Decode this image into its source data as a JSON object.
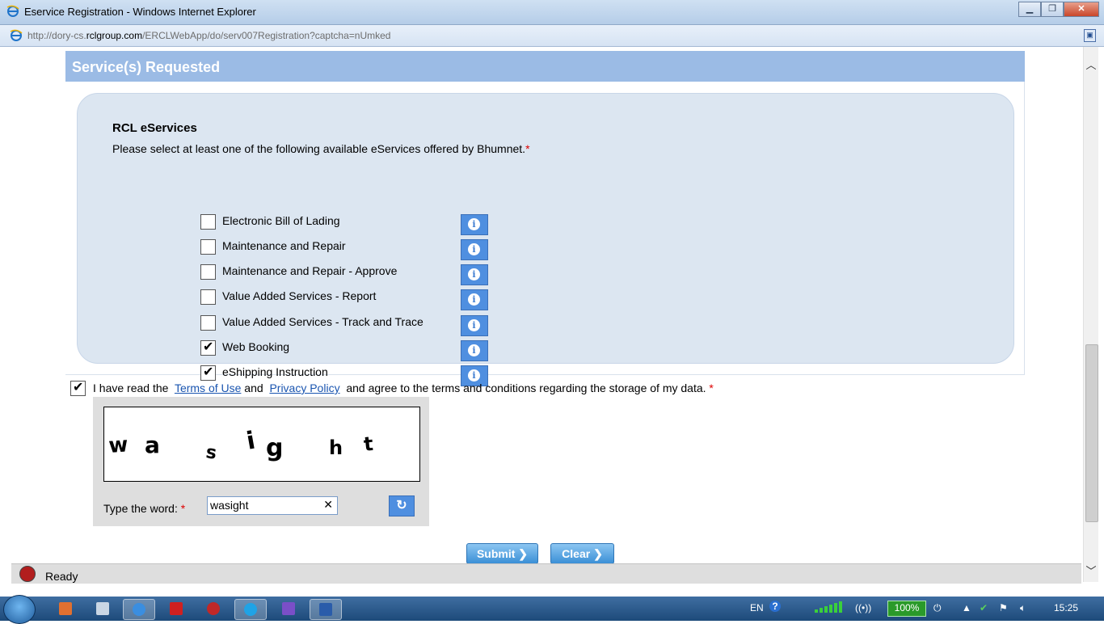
{
  "window": {
    "title": "Eservice Registration - Windows Internet Explorer",
    "url_prefix": "http://dory-cs.",
    "url_domain": "rclgroup.com",
    "url_path": "/ERCLWebApp/do/serv007Registration?captcha=nUmked",
    "minimize": "▁",
    "restore": "❐",
    "close": "✕"
  },
  "section": {
    "title": "Service(s) Requested"
  },
  "panel": {
    "title": "RCL eServices",
    "description": "Please select at least one of the following available eServices offered by Bhumnet.",
    "required_mark": "*"
  },
  "services": [
    {
      "label": "Electronic Bill of Lading",
      "checked": false
    },
    {
      "label": "Maintenance and Repair",
      "checked": false
    },
    {
      "label": "Maintenance and Repair - Approve",
      "checked": false
    },
    {
      "label": "Value Added Services - Report",
      "checked": false
    },
    {
      "label": "Value Added Services - Track and Trace",
      "checked": false
    },
    {
      "label": "Web Booking",
      "checked": true
    },
    {
      "label": "eShipping Instruction",
      "checked": true
    }
  ],
  "info_glyph": "i",
  "terms": {
    "checked": true,
    "prefix": "I have read the",
    "terms_link": "Terms of Use",
    "and": "and",
    "privacy_link": "Privacy Policy",
    "suffix": "and agree to the terms and conditions regarding the storage of my data.",
    "required_mark": "*"
  },
  "captcha": {
    "image_word": "wasight",
    "label": "Type the word:",
    "required_mark": "*",
    "value": "wasight",
    "clear_glyph": "✕",
    "refresh_glyph": "↻"
  },
  "buttons": {
    "submit": "Submit ❯",
    "clear": "Clear ❯"
  },
  "status": {
    "text": "Ready"
  },
  "taskbar": {
    "language": "EN",
    "battery": "100%",
    "time": "15:25"
  },
  "colors": {
    "section_header": "#9bbbe5",
    "panel_bg": "#dce6f1",
    "info_button": "#4f8fe0",
    "link": "#1a55b0",
    "required": "#dd0000"
  }
}
